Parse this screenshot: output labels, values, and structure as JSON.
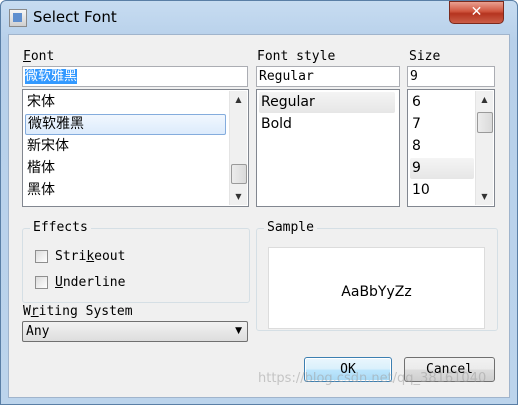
{
  "window": {
    "title": "Select Font",
    "close_icon": "✕"
  },
  "font": {
    "label": "Font",
    "label_mnemonic": "F",
    "label_rest": "ont",
    "value": "微软雅黑",
    "items": [
      "宋体",
      "微软雅黑",
      "新宋体",
      "楷体",
      "黑体"
    ],
    "selected": "微软雅黑"
  },
  "style": {
    "label": "Font style",
    "value": "Regular",
    "items": [
      "Regular",
      "Bold"
    ],
    "selected": "Regular"
  },
  "size": {
    "label": "Size",
    "value": "9",
    "items": [
      "6",
      "7",
      "8",
      "9",
      "10"
    ],
    "selected": "9"
  },
  "effects": {
    "label": "Effects",
    "strikeout": {
      "label": "Strikeout",
      "pre": "Stri",
      "mnemonic": "k",
      "post": "eout",
      "checked": false
    },
    "underline": {
      "label": "Underline",
      "pre": "",
      "mnemonic": "U",
      "post": "nderline",
      "checked": false
    }
  },
  "writing_system": {
    "label": "Writing System",
    "pre": "W",
    "mnemonic": "r",
    "post": "iting System",
    "value": "Any"
  },
  "sample": {
    "label": "Sample",
    "text": "AaBbYyZz"
  },
  "buttons": {
    "ok": "OK",
    "cancel": "Cancel"
  },
  "watermark": "https://blog.csdn.net/qq_38161040",
  "colors": {
    "selection": "#3399ff",
    "default_button_border": "#3c7fb1"
  }
}
